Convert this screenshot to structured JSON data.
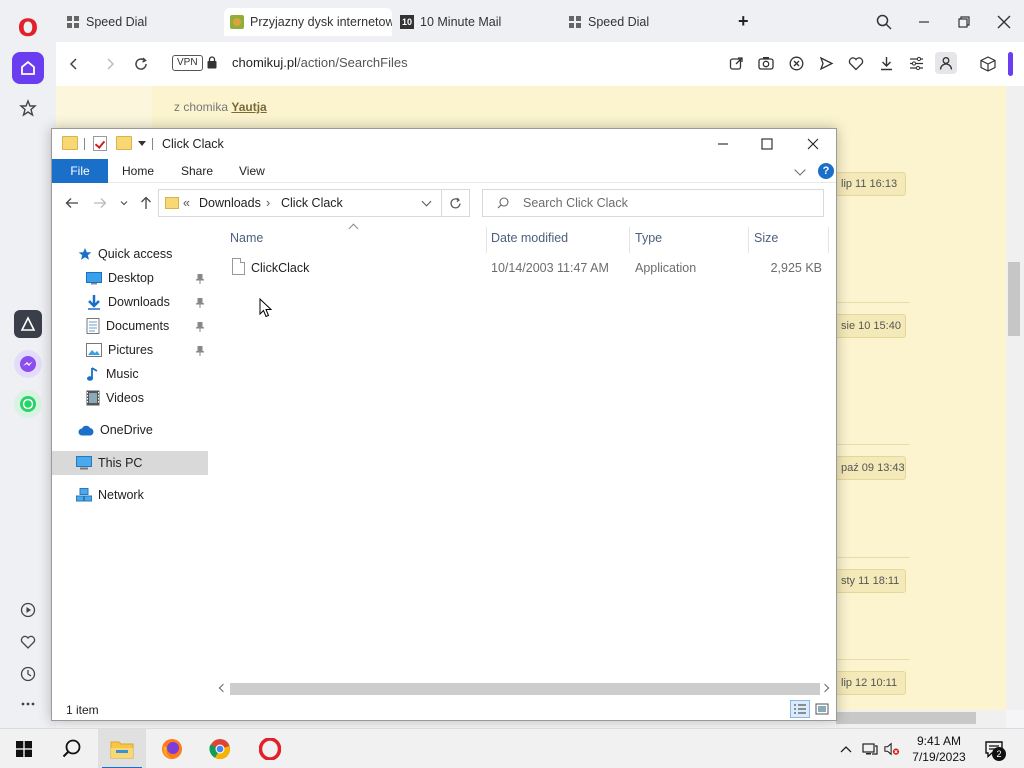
{
  "browser": {
    "tabs": [
      {
        "label": "Speed Dial",
        "icon": "speed-dial-icon"
      },
      {
        "label": "Przyjazny dysk internetow",
        "icon": "chomikuj-favicon",
        "active": true
      },
      {
        "label": "10 Minute Mail",
        "icon": "tenminutemail-favicon"
      },
      {
        "label": "Speed Dial",
        "icon": "speed-dial-icon"
      }
    ],
    "vpn_label": "VPN",
    "url_host": "chomikuj.pl",
    "url_path": "/action/SearchFiles",
    "accent_color": "#6a3df0"
  },
  "page": {
    "chomik_prefix": "z chomika",
    "chomik_user": "Yautja",
    "dates": [
      "lip 11 16:13",
      "sie 10 15:40",
      "paź 09 13:43",
      "sty 11 18:11",
      "lip 12 10:11"
    ]
  },
  "explorer": {
    "title": "Click Clack",
    "ribbon": {
      "file": "File",
      "home": "Home",
      "share": "Share",
      "view": "View",
      "help": "?"
    },
    "address": {
      "prefix": "«",
      "crumb1": "Downloads",
      "sep": "›",
      "crumb2": "Click Clack"
    },
    "search_placeholder": "Search Click Clack",
    "nav": {
      "quick_access": "Quick access",
      "desktop": "Desktop",
      "downloads": "Downloads",
      "documents": "Documents",
      "pictures": "Pictures",
      "music": "Music",
      "videos": "Videos",
      "onedrive": "OneDrive",
      "this_pc": "This PC",
      "network": "Network"
    },
    "columns": {
      "name": "Name",
      "date": "Date modified",
      "type": "Type",
      "size": "Size"
    },
    "files": [
      {
        "name": "ClickClack",
        "date": "10/14/2003 11:47 AM",
        "type": "Application",
        "size": "2,925 KB"
      }
    ],
    "status": "1 item"
  },
  "taskbar": {
    "time": "9:41 AM",
    "date": "7/19/2023",
    "notifications": "2"
  }
}
